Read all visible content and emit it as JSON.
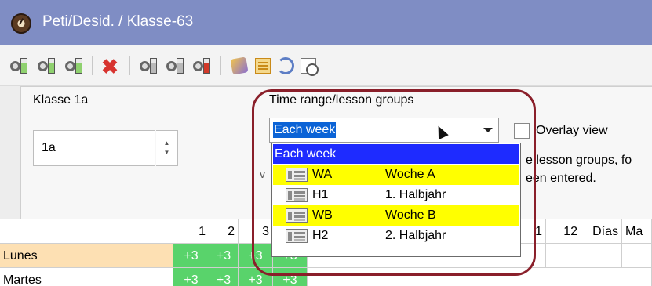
{
  "window": {
    "title": "Peti/Desid. / Klasse-63"
  },
  "toolbar": {
    "icons": [
      "gear-green-bars-icon",
      "gears-green-bars-icon",
      "gear-small-green-bars-icon",
      "delete-x-icon",
      "gear-grey-bars-icon",
      "gears-grey-bars-icon",
      "gear-red-bars-icon",
      "wand-icon",
      "book-icon",
      "swap-icon",
      "clock-doc-icon"
    ]
  },
  "klasse": {
    "label": "Klasse 1a",
    "value": "1a"
  },
  "time_range": {
    "label": "Time range/lesson groups",
    "selected": "Each week",
    "dropdown_header": "Each week",
    "options": [
      {
        "code": "WA",
        "name": "Woche A",
        "highlight": true
      },
      {
        "code": "H1",
        "name": "1. Halbjahr",
        "highlight": false
      },
      {
        "code": "WB",
        "name": "Woche B",
        "highlight": true
      },
      {
        "code": "H2",
        "name": "2. Halbjahr",
        "highlight": false
      }
    ]
  },
  "overlay": {
    "label": "Overlay view"
  },
  "hint": {
    "line1": "e lesson groups, fo",
    "line2": "een entered."
  },
  "left_fragment": "v",
  "grid": {
    "columns": [
      "1",
      "2",
      "3",
      "1",
      "12",
      "Días",
      "Ma"
    ],
    "rows": [
      {
        "label": "Lunes",
        "cells": [
          "+3",
          "+3",
          "+3",
          "+3"
        ]
      },
      {
        "label": "Martes",
        "cells": [
          "+3",
          "+3",
          "+3",
          "+3"
        ]
      }
    ]
  }
}
